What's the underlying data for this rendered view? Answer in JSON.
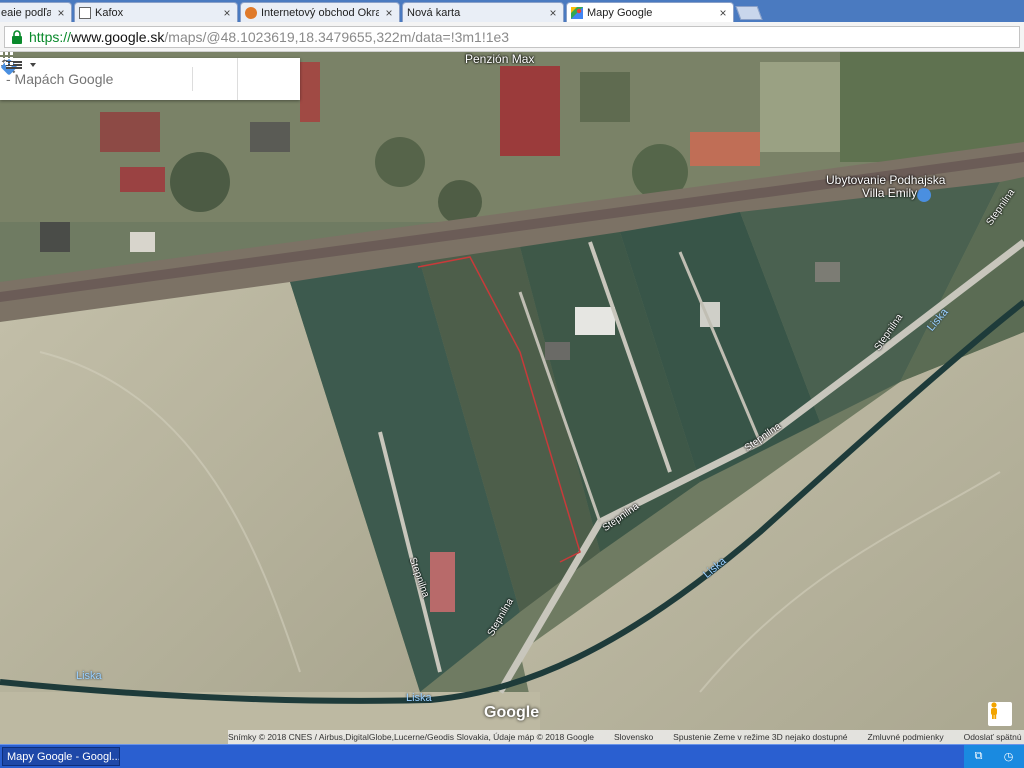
{
  "browser": {
    "tabs": [
      {
        "title": "eaie podľa",
        "active": false
      },
      {
        "title": "Kafox",
        "active": false
      },
      {
        "title": "Internetový obchod Okrasn",
        "active": false
      },
      {
        "title": "Nová karta",
        "active": false
      },
      {
        "title": "Mapy Google",
        "active": true
      }
    ],
    "url": {
      "scheme": "https://",
      "host": "www.google.sk",
      "path": "/maps/@48.1023619,18.3479655,322m/data=!3m1!1e3"
    }
  },
  "map": {
    "search_placeholder": "Hľadajte v Mapách Google",
    "search_visible_text": "- Mapách Google",
    "labels": {
      "penzion": "Penzión Max",
      "ubytovanie_line1": "Ubytovanie Podhajska",
      "ubytovanie_line2": "Villa Emily",
      "road1": "Stepnilna",
      "road2": "Stepnilna",
      "road3": "Stepnilna",
      "road4": "Stepnilna",
      "road5": "Stepnilna",
      "road6": "Stepnilna",
      "river1": "Liska",
      "river2": "Liska",
      "river3": "Liska",
      "river4": "Liska"
    },
    "logo": "Google",
    "attribution": {
      "imagery": "Snímky © 2018 CNES / Airbus,DigitalGlobe,Lucerne/Geodis Slovakia, Údaje máp © 2018 Google",
      "country": "Slovensko",
      "feedback": "Spustenie Zeme v režime 3D nejako dostupné",
      "terms": "Zmluvné podmienky",
      "report": "Odoslať spätnú väzbu"
    }
  },
  "taskbar": {
    "item": "Mapy Google - Googl..."
  },
  "colors": {
    "tabstrip": "#4a7ac0",
    "taskbar": "#2a5fd0",
    "url_green": "#0a8a2c",
    "field": "#b9b59f"
  },
  "icons": {
    "lock": "lock-icon",
    "search": "search-icon",
    "directions": "directions-icon",
    "menu": "menu-icon",
    "apps": "apps-grid-icon",
    "pegman": "pegman-icon"
  }
}
